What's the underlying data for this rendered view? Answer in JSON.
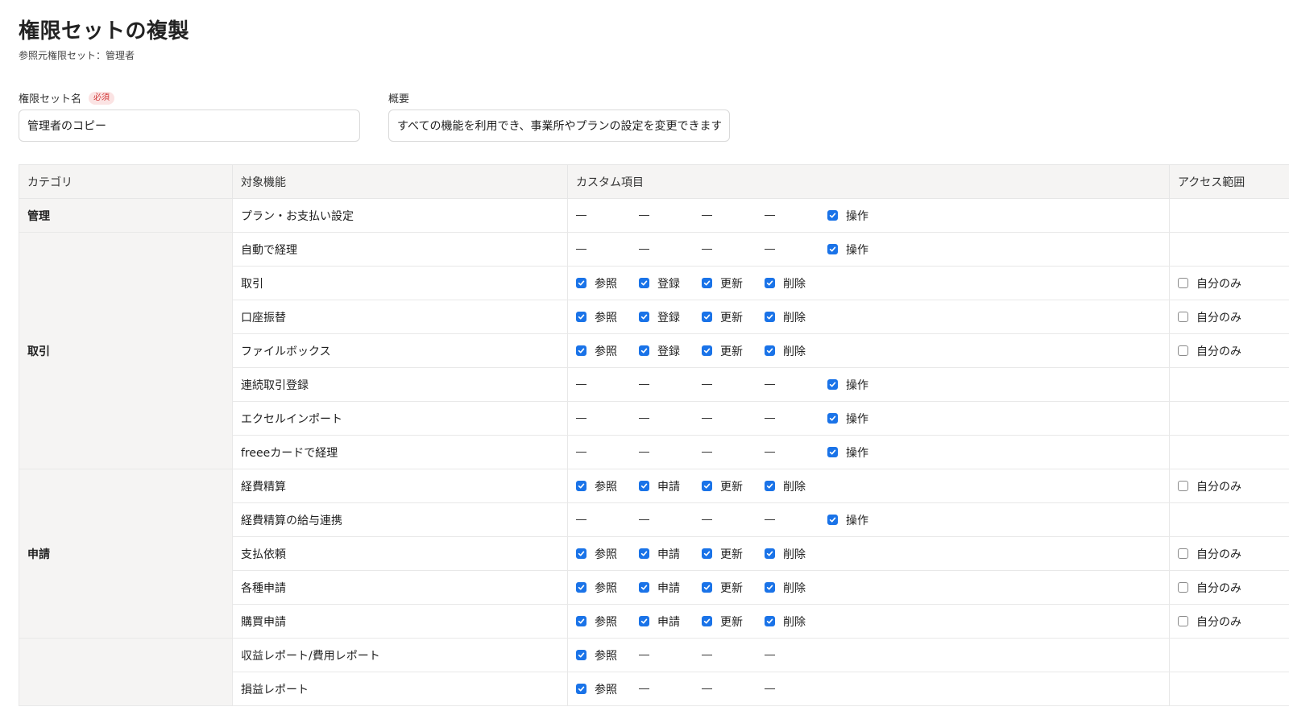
{
  "header": {
    "title": "権限セットの複製",
    "subtitle": "参照元権限セット：管理者"
  },
  "form": {
    "name": {
      "label": "権限セット名",
      "required_badge": "必須",
      "value": "管理者のコピー"
    },
    "description": {
      "label": "概要",
      "value": "すべての機能を利用でき、事業所やプランの設定を変更できます"
    }
  },
  "table": {
    "columns": {
      "category": "カテゴリ",
      "feature": "対象機能",
      "custom": "カスタム項目",
      "access": "アクセス範囲"
    },
    "groups": [
      {
        "category": "管理",
        "rows": [
          {
            "feature": "プラン・お支払い設定",
            "items": [
              {
                "type": "dash"
              },
              {
                "type": "dash"
              },
              {
                "type": "dash"
              },
              {
                "type": "dash"
              },
              {
                "type": "check",
                "checked": true,
                "label": "操作"
              }
            ],
            "access": null
          }
        ]
      },
      {
        "category": "取引",
        "rows": [
          {
            "feature": "自動で経理",
            "items": [
              {
                "type": "dash"
              },
              {
                "type": "dash"
              },
              {
                "type": "dash"
              },
              {
                "type": "dash"
              },
              {
                "type": "check",
                "checked": true,
                "label": "操作"
              }
            ],
            "access": null
          },
          {
            "feature": "取引",
            "items": [
              {
                "type": "check",
                "checked": true,
                "label": "参照"
              },
              {
                "type": "check",
                "checked": true,
                "label": "登録"
              },
              {
                "type": "check",
                "checked": true,
                "label": "更新"
              },
              {
                "type": "check",
                "checked": true,
                "label": "削除"
              }
            ],
            "access": {
              "checked": false,
              "label": "自分のみ"
            }
          },
          {
            "feature": "口座振替",
            "items": [
              {
                "type": "check",
                "checked": true,
                "label": "参照"
              },
              {
                "type": "check",
                "checked": true,
                "label": "登録"
              },
              {
                "type": "check",
                "checked": true,
                "label": "更新"
              },
              {
                "type": "check",
                "checked": true,
                "label": "削除"
              }
            ],
            "access": {
              "checked": false,
              "label": "自分のみ"
            }
          },
          {
            "feature": "ファイルボックス",
            "items": [
              {
                "type": "check",
                "checked": true,
                "label": "参照"
              },
              {
                "type": "check",
                "checked": true,
                "label": "登録"
              },
              {
                "type": "check",
                "checked": true,
                "label": "更新"
              },
              {
                "type": "check",
                "checked": true,
                "label": "削除"
              }
            ],
            "access": {
              "checked": false,
              "label": "自分のみ"
            }
          },
          {
            "feature": "連続取引登録",
            "items": [
              {
                "type": "dash"
              },
              {
                "type": "dash"
              },
              {
                "type": "dash"
              },
              {
                "type": "dash"
              },
              {
                "type": "check",
                "checked": true,
                "label": "操作"
              }
            ],
            "access": null
          },
          {
            "feature": "エクセルインポート",
            "items": [
              {
                "type": "dash"
              },
              {
                "type": "dash"
              },
              {
                "type": "dash"
              },
              {
                "type": "dash"
              },
              {
                "type": "check",
                "checked": true,
                "label": "操作"
              }
            ],
            "access": null
          },
          {
            "feature": "freeeカードで経理",
            "items": [
              {
                "type": "dash"
              },
              {
                "type": "dash"
              },
              {
                "type": "dash"
              },
              {
                "type": "dash"
              },
              {
                "type": "check",
                "checked": true,
                "label": "操作"
              }
            ],
            "access": null
          }
        ]
      },
      {
        "category": "申請",
        "rows": [
          {
            "feature": "経費精算",
            "items": [
              {
                "type": "check",
                "checked": true,
                "label": "参照"
              },
              {
                "type": "check",
                "checked": true,
                "label": "申請"
              },
              {
                "type": "check",
                "checked": true,
                "label": "更新"
              },
              {
                "type": "check",
                "checked": true,
                "label": "削除"
              }
            ],
            "access": {
              "checked": false,
              "label": "自分のみ"
            }
          },
          {
            "feature": "経費精算の給与連携",
            "items": [
              {
                "type": "dash"
              },
              {
                "type": "dash"
              },
              {
                "type": "dash"
              },
              {
                "type": "dash"
              },
              {
                "type": "check",
                "checked": true,
                "label": "操作"
              }
            ],
            "access": null
          },
          {
            "feature": "支払依頼",
            "items": [
              {
                "type": "check",
                "checked": true,
                "label": "参照"
              },
              {
                "type": "check",
                "checked": true,
                "label": "申請"
              },
              {
                "type": "check",
                "checked": true,
                "label": "更新"
              },
              {
                "type": "check",
                "checked": true,
                "label": "削除"
              }
            ],
            "access": {
              "checked": false,
              "label": "自分のみ"
            }
          },
          {
            "feature": "各種申請",
            "items": [
              {
                "type": "check",
                "checked": true,
                "label": "参照"
              },
              {
                "type": "check",
                "checked": true,
                "label": "申請"
              },
              {
                "type": "check",
                "checked": true,
                "label": "更新"
              },
              {
                "type": "check",
                "checked": true,
                "label": "削除"
              }
            ],
            "access": {
              "checked": false,
              "label": "自分のみ"
            }
          },
          {
            "feature": "購買申請",
            "items": [
              {
                "type": "check",
                "checked": true,
                "label": "参照"
              },
              {
                "type": "check",
                "checked": true,
                "label": "申請"
              },
              {
                "type": "check",
                "checked": true,
                "label": "更新"
              },
              {
                "type": "check",
                "checked": true,
                "label": "削除"
              }
            ],
            "access": {
              "checked": false,
              "label": "自分のみ"
            }
          }
        ]
      },
      {
        "category": "",
        "rows": [
          {
            "feature": "収益レポート/費用レポート",
            "items": [
              {
                "type": "check",
                "checked": true,
                "label": "参照"
              },
              {
                "type": "dash"
              },
              {
                "type": "dash"
              },
              {
                "type": "dash"
              }
            ],
            "access": null
          },
          {
            "feature": "損益レポート",
            "items": [
              {
                "type": "check",
                "checked": true,
                "label": "参照"
              },
              {
                "type": "dash"
              },
              {
                "type": "dash"
              },
              {
                "type": "dash"
              }
            ],
            "access": null
          }
        ]
      }
    ]
  },
  "colors": {
    "accent": "#1a73e8",
    "required_text": "#d23b3b",
    "required_bg": "#fbe3e3",
    "header_bg": "#f5f4f3"
  }
}
